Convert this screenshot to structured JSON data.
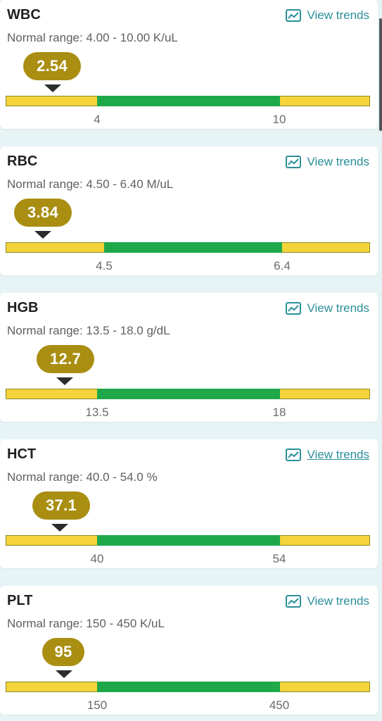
{
  "view_trends_label": "View trends",
  "colors": {
    "pill": "#a98e12",
    "normal": "#1fa84a",
    "abnormal": "#f5d33a",
    "link": "#2a8f9a"
  },
  "tests": [
    {
      "name": "WBC",
      "range_text": "Normal range: 4.00 - 10.00 K/uL",
      "value": "2.54",
      "low": "4",
      "high": "10",
      "value_num": 2.54,
      "low_num": 4,
      "high_num": 10
    },
    {
      "name": "RBC",
      "range_text": "Normal range: 4.50 - 6.40 M/uL",
      "value": "3.84",
      "low": "4.5",
      "high": "6.4",
      "value_num": 3.84,
      "low_num": 4.5,
      "high_num": 6.4
    },
    {
      "name": "HGB",
      "range_text": "Normal range: 13.5 - 18.0 g/dL",
      "value": "12.7",
      "low": "13.5",
      "high": "18",
      "value_num": 12.7,
      "low_num": 13.5,
      "high_num": 18
    },
    {
      "name": "HCT",
      "range_text": "Normal range: 40.0 - 54.0 %",
      "value": "37.1",
      "low": "40",
      "high": "54",
      "value_num": 37.1,
      "low_num": 40,
      "high_num": 54
    },
    {
      "name": "PLT",
      "range_text": "Normal range: 150 - 450 K/uL",
      "value": "95",
      "low": "150",
      "high": "450",
      "value_num": 95,
      "low_num": 150,
      "high_num": 450
    }
  ]
}
